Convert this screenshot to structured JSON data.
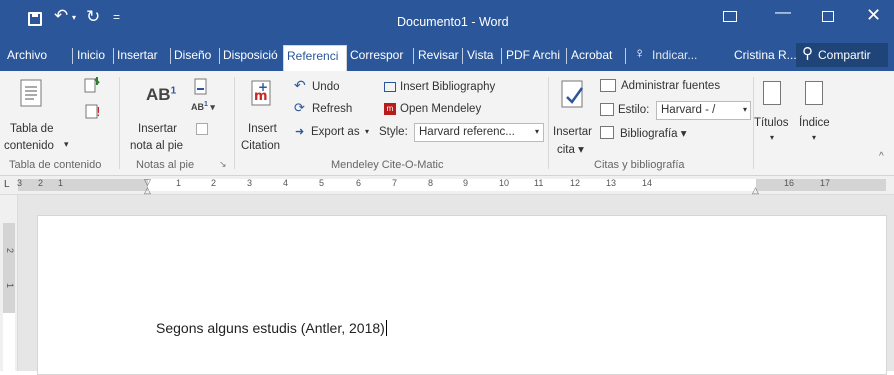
{
  "title": "Documento1 - Word",
  "tabs": [
    "Archivo",
    "Inicio",
    "Insertar",
    "Diseño",
    "Disposició",
    "Referenci",
    "Correspor",
    "Revisar",
    "Vista",
    "PDF Archi",
    "Acrobat"
  ],
  "tell_me": "Indicar...",
  "user": "Cristina R...",
  "share": "Compartir",
  "ribbon": {
    "toc_label1": "Tabla de",
    "toc_label2": "contenido",
    "toc_arrow": "▾",
    "toc_group": "Tabla de contenido",
    "footnote_big": "AB",
    "footnote_sup": "1",
    "footnote_label1": "Insertar",
    "footnote_label2": "nota al pie",
    "notes_group": "Notas al pie",
    "ab_small": "AB",
    "ab_small_sup": "1",
    "insert_label1": "Insert",
    "insert_label2": "Citation",
    "undo": "Undo",
    "refresh": "Refresh",
    "export": "Export as",
    "insert_bib": "Insert Bibliography",
    "open_mendeley": "Open Mendeley",
    "style_label": "Style:",
    "style_value": "Harvard referenc...",
    "mendeley_group": "Mendeley Cite-O-Matic",
    "insertar_cita1": "Insertar",
    "insertar_cita2": "cita",
    "admin_fuentes": "Administrar fuentes",
    "estilo_label": "Estilo:",
    "estilo_value": "Harvard - /",
    "bibliografia": "Bibliografía",
    "citas_group": "Citas y bibliografía",
    "titulos": "Títulos",
    "indice": "Índice"
  },
  "ruler_marks": [
    "3",
    "2",
    "1",
    "1",
    "2",
    "3",
    "4",
    "5",
    "6",
    "7",
    "8",
    "9",
    "10",
    "11",
    "12",
    "13",
    "14",
    "16",
    "17"
  ],
  "vruler_marks": [
    "2",
    "1"
  ],
  "document": {
    "text": "Segons alguns estudis (Antler, 2018)"
  }
}
